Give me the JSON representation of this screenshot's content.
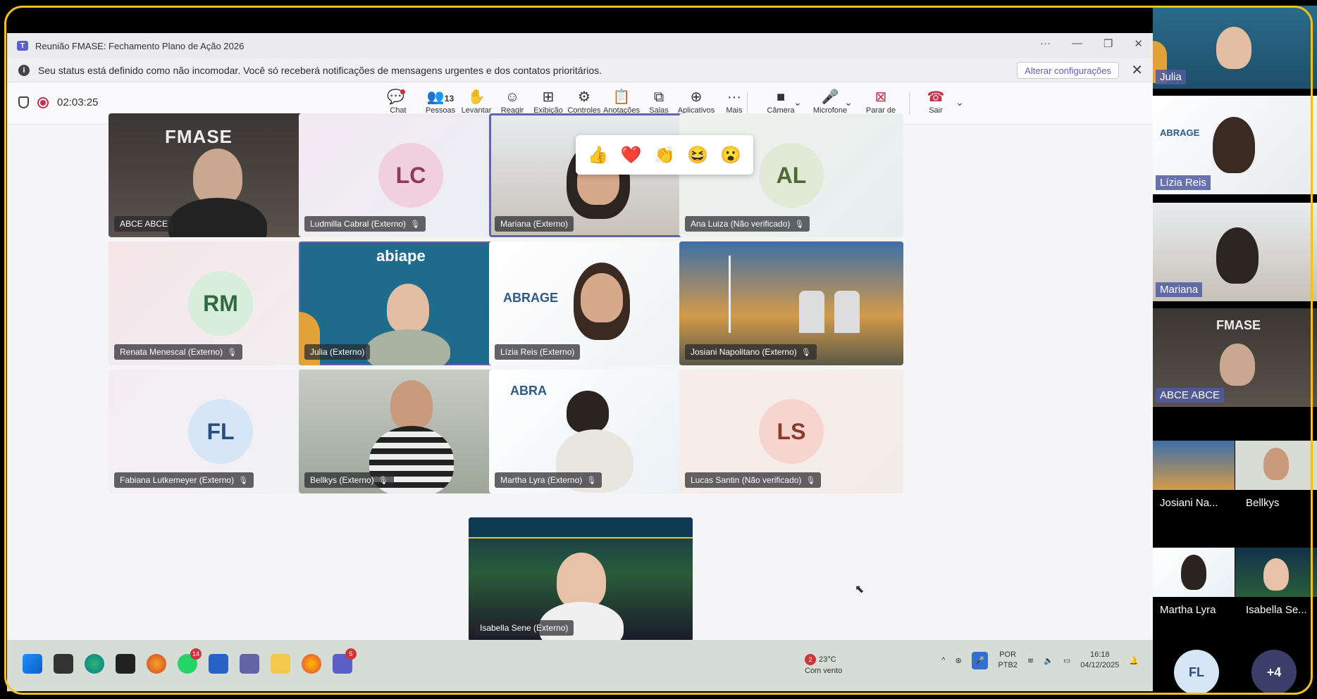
{
  "window": {
    "title": "Reunião FMASE: Fechamento Plano de Ação 2026",
    "controls": [
      "···",
      "—",
      "❐",
      "✕"
    ]
  },
  "notification": {
    "text": "Seu status está definido como não incomodar. Você só receberá notificações de mensagens urgentes e dos contatos prioritários.",
    "button": "Alterar configurações"
  },
  "meeting": {
    "timer": "02:03:25"
  },
  "toolbar": [
    {
      "label": "Chat",
      "icon": "💬"
    },
    {
      "label": "Pessoas",
      "icon": "👥",
      "count": "13"
    },
    {
      "label": "Levantar",
      "icon": "✋"
    },
    {
      "label": "Reagir",
      "icon": "☺"
    },
    {
      "label": "Exibição",
      "icon": "⊞"
    },
    {
      "label": "Controles",
      "icon": "⚙"
    },
    {
      "label": "Anotações",
      "icon": "📋"
    },
    {
      "label": "Salas",
      "icon": "⧉"
    },
    {
      "label": "Aplicativos",
      "icon": "⊕"
    },
    {
      "label": "Mais",
      "icon": "···"
    },
    {
      "label": "Câmera",
      "icon": "■"
    },
    {
      "label": "Microfone",
      "icon": "🎤"
    },
    {
      "label": "Parar de co...",
      "icon": "⊠"
    },
    {
      "label": "Sair",
      "icon": "☎"
    }
  ],
  "reactions": [
    "👍",
    "❤️",
    "👏",
    "😆",
    "😮"
  ],
  "tiles": [
    {
      "name": "ABCE ABCE",
      "type": "video",
      "logo": "FMASE"
    },
    {
      "name": "Ludmilla Cabral (Externo)",
      "type": "avatar",
      "initials": "LC",
      "muted": true
    },
    {
      "name": "Mariana (Externo)",
      "type": "video"
    },
    {
      "name": "Ana Luiza (Não verificado)",
      "type": "avatar",
      "initials": "AL",
      "muted": true
    },
    {
      "name": "Renata Menescal (Externo)",
      "type": "avatar",
      "initials": "RM",
      "muted": true
    },
    {
      "name": "Julia (Externo)",
      "type": "video",
      "logo": "abiape"
    },
    {
      "name": "Lízia Reis (Externo)",
      "type": "video",
      "logo": "ABRAGE"
    },
    {
      "name": "Josiani Napolitano (Externo)",
      "type": "video",
      "muted": true
    },
    {
      "name": "Fabiana Lutkemeyer (Externo)",
      "type": "avatar",
      "initials": "FL",
      "muted": true
    },
    {
      "name": "Bellkys (Externo)",
      "type": "video",
      "muted": true
    },
    {
      "name": "Martha Lyra (Externo)",
      "type": "video",
      "logo": "ABRA",
      "muted": true
    },
    {
      "name": "Lucas Santin (Não verificado)",
      "type": "avatar",
      "initials": "LS",
      "muted": true
    },
    {
      "name": "Isabella Sene (Externo)",
      "type": "video"
    }
  ],
  "taskbar": {
    "weather": {
      "temp": "23°C",
      "desc": "Com vento",
      "badge": "2"
    },
    "lang": [
      "POR",
      "PTB2"
    ],
    "time": "16:18",
    "date": "04/12/2025",
    "badges": {
      "whatsapp": "14",
      "teams": "5"
    }
  },
  "sidebar": [
    {
      "name": "Julia"
    },
    {
      "name": "Lízia Reis"
    },
    {
      "name": "Mariana"
    },
    {
      "name": "ABCE ABCE"
    },
    {
      "name": "Josiani Na..."
    },
    {
      "name": "Bellkys"
    },
    {
      "name": "Martha Lyra"
    },
    {
      "name": "Isabella Se..."
    },
    {
      "initials": "FL"
    },
    {
      "more": "+4"
    }
  ]
}
